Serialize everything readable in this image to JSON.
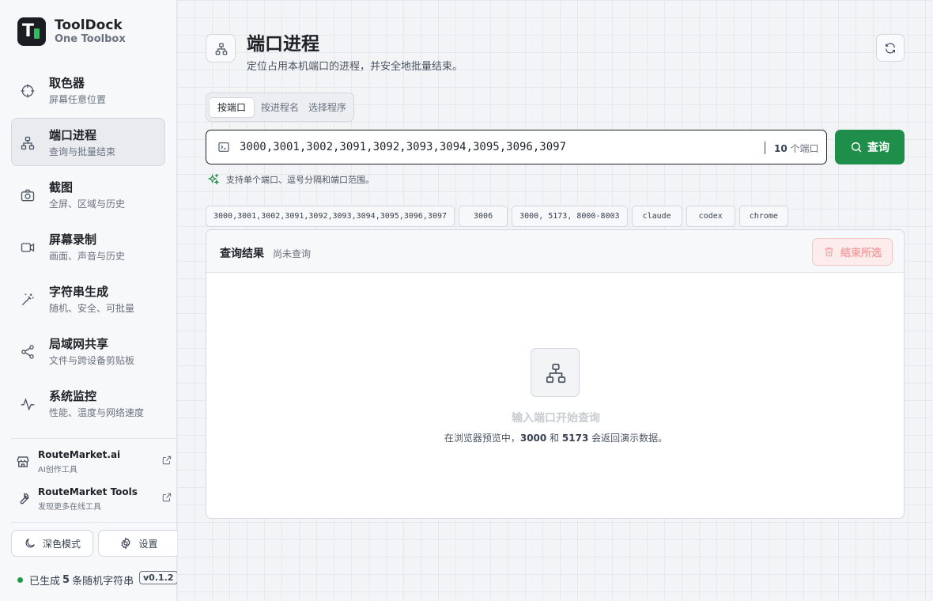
{
  "brand": {
    "name": "ToolDock",
    "subtitle": "One Toolbox",
    "logo_letter": "T"
  },
  "sidebar": {
    "items": [
      {
        "label": "取色器",
        "desc": "屏幕任意位置",
        "icon": "crosshair-icon"
      },
      {
        "label": "端口进程",
        "desc": "查询与批量结束",
        "icon": "network-icon",
        "active": true
      },
      {
        "label": "截图",
        "desc": "全屏、区域与历史",
        "icon": "camera-icon"
      },
      {
        "label": "屏幕录制",
        "desc": "画面、声音与历史",
        "icon": "video-icon"
      },
      {
        "label": "字符串生成",
        "desc": "随机、安全、可批量",
        "icon": "wand-icon"
      },
      {
        "label": "局域网共享",
        "desc": "文件与跨设备剪贴板",
        "icon": "share-icon"
      },
      {
        "label": "系统监控",
        "desc": "性能、温度与网络速度",
        "icon": "activity-icon"
      }
    ],
    "links": [
      {
        "name": "RouteMarket.ai",
        "desc": "AI创作工具"
      },
      {
        "name": "RouteMarket Tools",
        "desc": "发现更多在线工具"
      }
    ],
    "dark_mode_label": "深色模式",
    "settings_label": "设置",
    "status": {
      "prefix": "已生成",
      "count": "5",
      "suffix": "条随机字符串",
      "version": "v0.1.2"
    }
  },
  "page": {
    "title": "端口进程",
    "subtitle": "定位占用本机端口的进程，并安全地批量结束。",
    "tabs": [
      "按端口",
      "按进程名",
      "选择程序"
    ],
    "active_tab": 0,
    "query": {
      "value": "3000,3001,3002,3091,3092,3093,3094,3095,3096,3097",
      "count": "10",
      "count_unit": "个端口",
      "button": "查询"
    },
    "hint": "支持单个端口、逗号分隔和端口范围。",
    "presets": [
      "3000,3001,3002,3091,3092,3093,3094,3095,3096,3097",
      "3006",
      "3000, 5173, 8000-8003",
      "claude",
      "codex",
      "chrome"
    ]
  },
  "results": {
    "title": "查询结果",
    "status": "尚未查询",
    "end_button": "结束所选",
    "empty_title": "输入端口开始查询",
    "empty_desc_prefix": "在浏览器预览中，",
    "empty_port_a": "3000",
    "empty_and": "和",
    "empty_port_b": "5173",
    "empty_desc_suffix": "会返回演示数据。"
  },
  "colors": {
    "accent": "#1e8e4a",
    "danger_soft": "#fdecec",
    "status_dot": "#1e9b4c"
  }
}
